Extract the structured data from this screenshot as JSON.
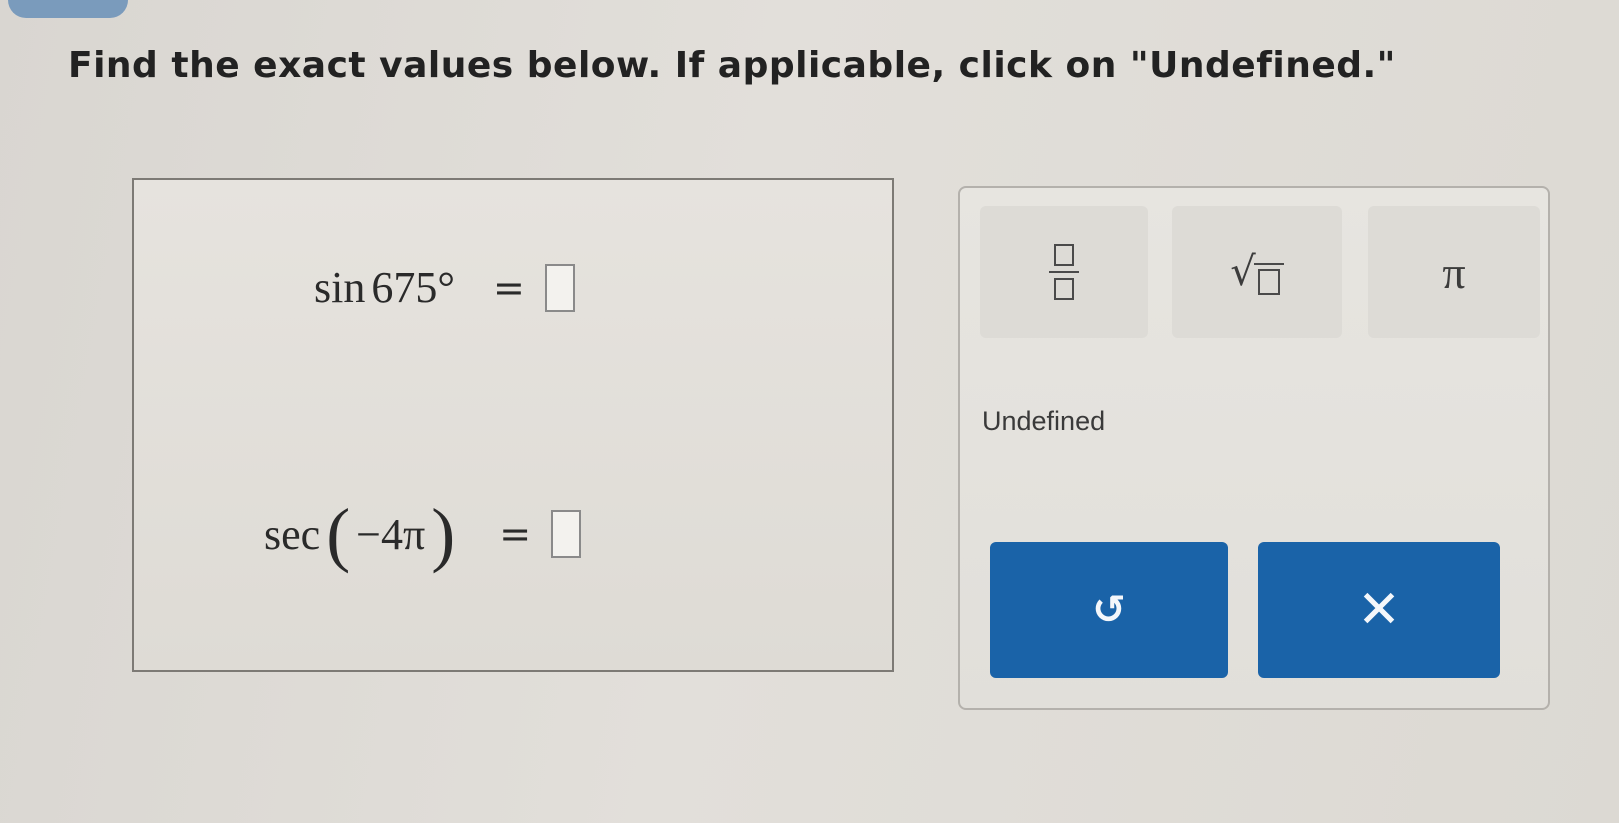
{
  "instructions": "Find the exact values below. If applicable, click on \"Undefined.\"",
  "questions": [
    {
      "func": "sin",
      "argument": "675°",
      "equals": "="
    },
    {
      "func": "sec",
      "open_paren": "(",
      "argument": "−4π",
      "close_paren": ")",
      "equals": "="
    }
  ],
  "keypad": {
    "pi_label": "π",
    "sqrt_label": "√",
    "undefined_label": "Undefined"
  },
  "icons": {
    "fraction": "fraction-icon",
    "sqrt": "square-root-icon",
    "undo": "undo-icon",
    "clear": "close-icon"
  },
  "colors": {
    "action_button": "#1a63a8",
    "key_background": "#dddbd6"
  }
}
